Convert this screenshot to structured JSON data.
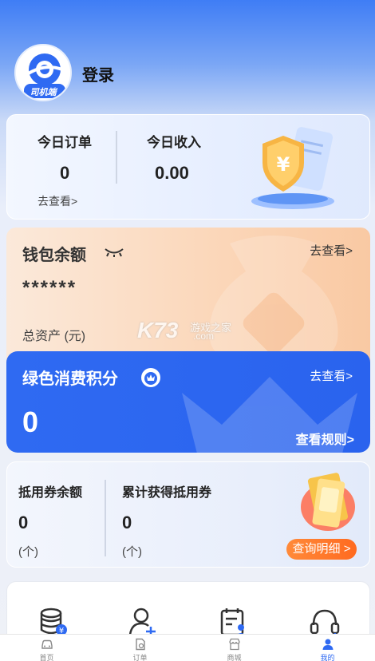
{
  "header": {
    "login_label": "登录",
    "avatar_badge": "司机端"
  },
  "orders_card": {
    "today_orders_label": "今日订单",
    "today_orders_value": "0",
    "view_link": "去查看>",
    "today_income_label": "今日收入",
    "today_income_value": "0.00"
  },
  "wallet_card": {
    "title": "钱包余额",
    "masked_balance": "******",
    "view_link": "去查看>",
    "total_assets_label": "总资产 (元)"
  },
  "green_points_card": {
    "title": "绿色消费积分",
    "value": "0",
    "view_link": "去查看>",
    "rules_link": "查看规则>"
  },
  "coupon_card": {
    "balance_label": "抵用券余额",
    "balance_value": "0",
    "balance_unit": "(个)",
    "earned_label": "累计获得抵用券",
    "earned_value": "0",
    "earned_unit": "(个)",
    "query_button": "查询明细 >"
  },
  "watermark": {
    "brand": "K73",
    "text": "游戏之家",
    "domain": ".com"
  },
  "services": [
    {
      "icon": "coins-icon"
    },
    {
      "icon": "add-user-icon"
    },
    {
      "icon": "calendar-user-icon"
    },
    {
      "icon": "headset-icon"
    }
  ],
  "tabbar": {
    "items": [
      {
        "label": "首页",
        "icon": "car-icon",
        "active": false
      },
      {
        "label": "订单",
        "icon": "order-icon",
        "active": false
      },
      {
        "label": "商城",
        "icon": "store-icon",
        "active": false
      },
      {
        "label": "我的",
        "icon": "user-icon",
        "active": true
      }
    ]
  },
  "colors": {
    "primary_blue": "#2f6af2",
    "wallet_orange": "#fbd6b8",
    "query_button_orange": "#ff6a1f"
  }
}
